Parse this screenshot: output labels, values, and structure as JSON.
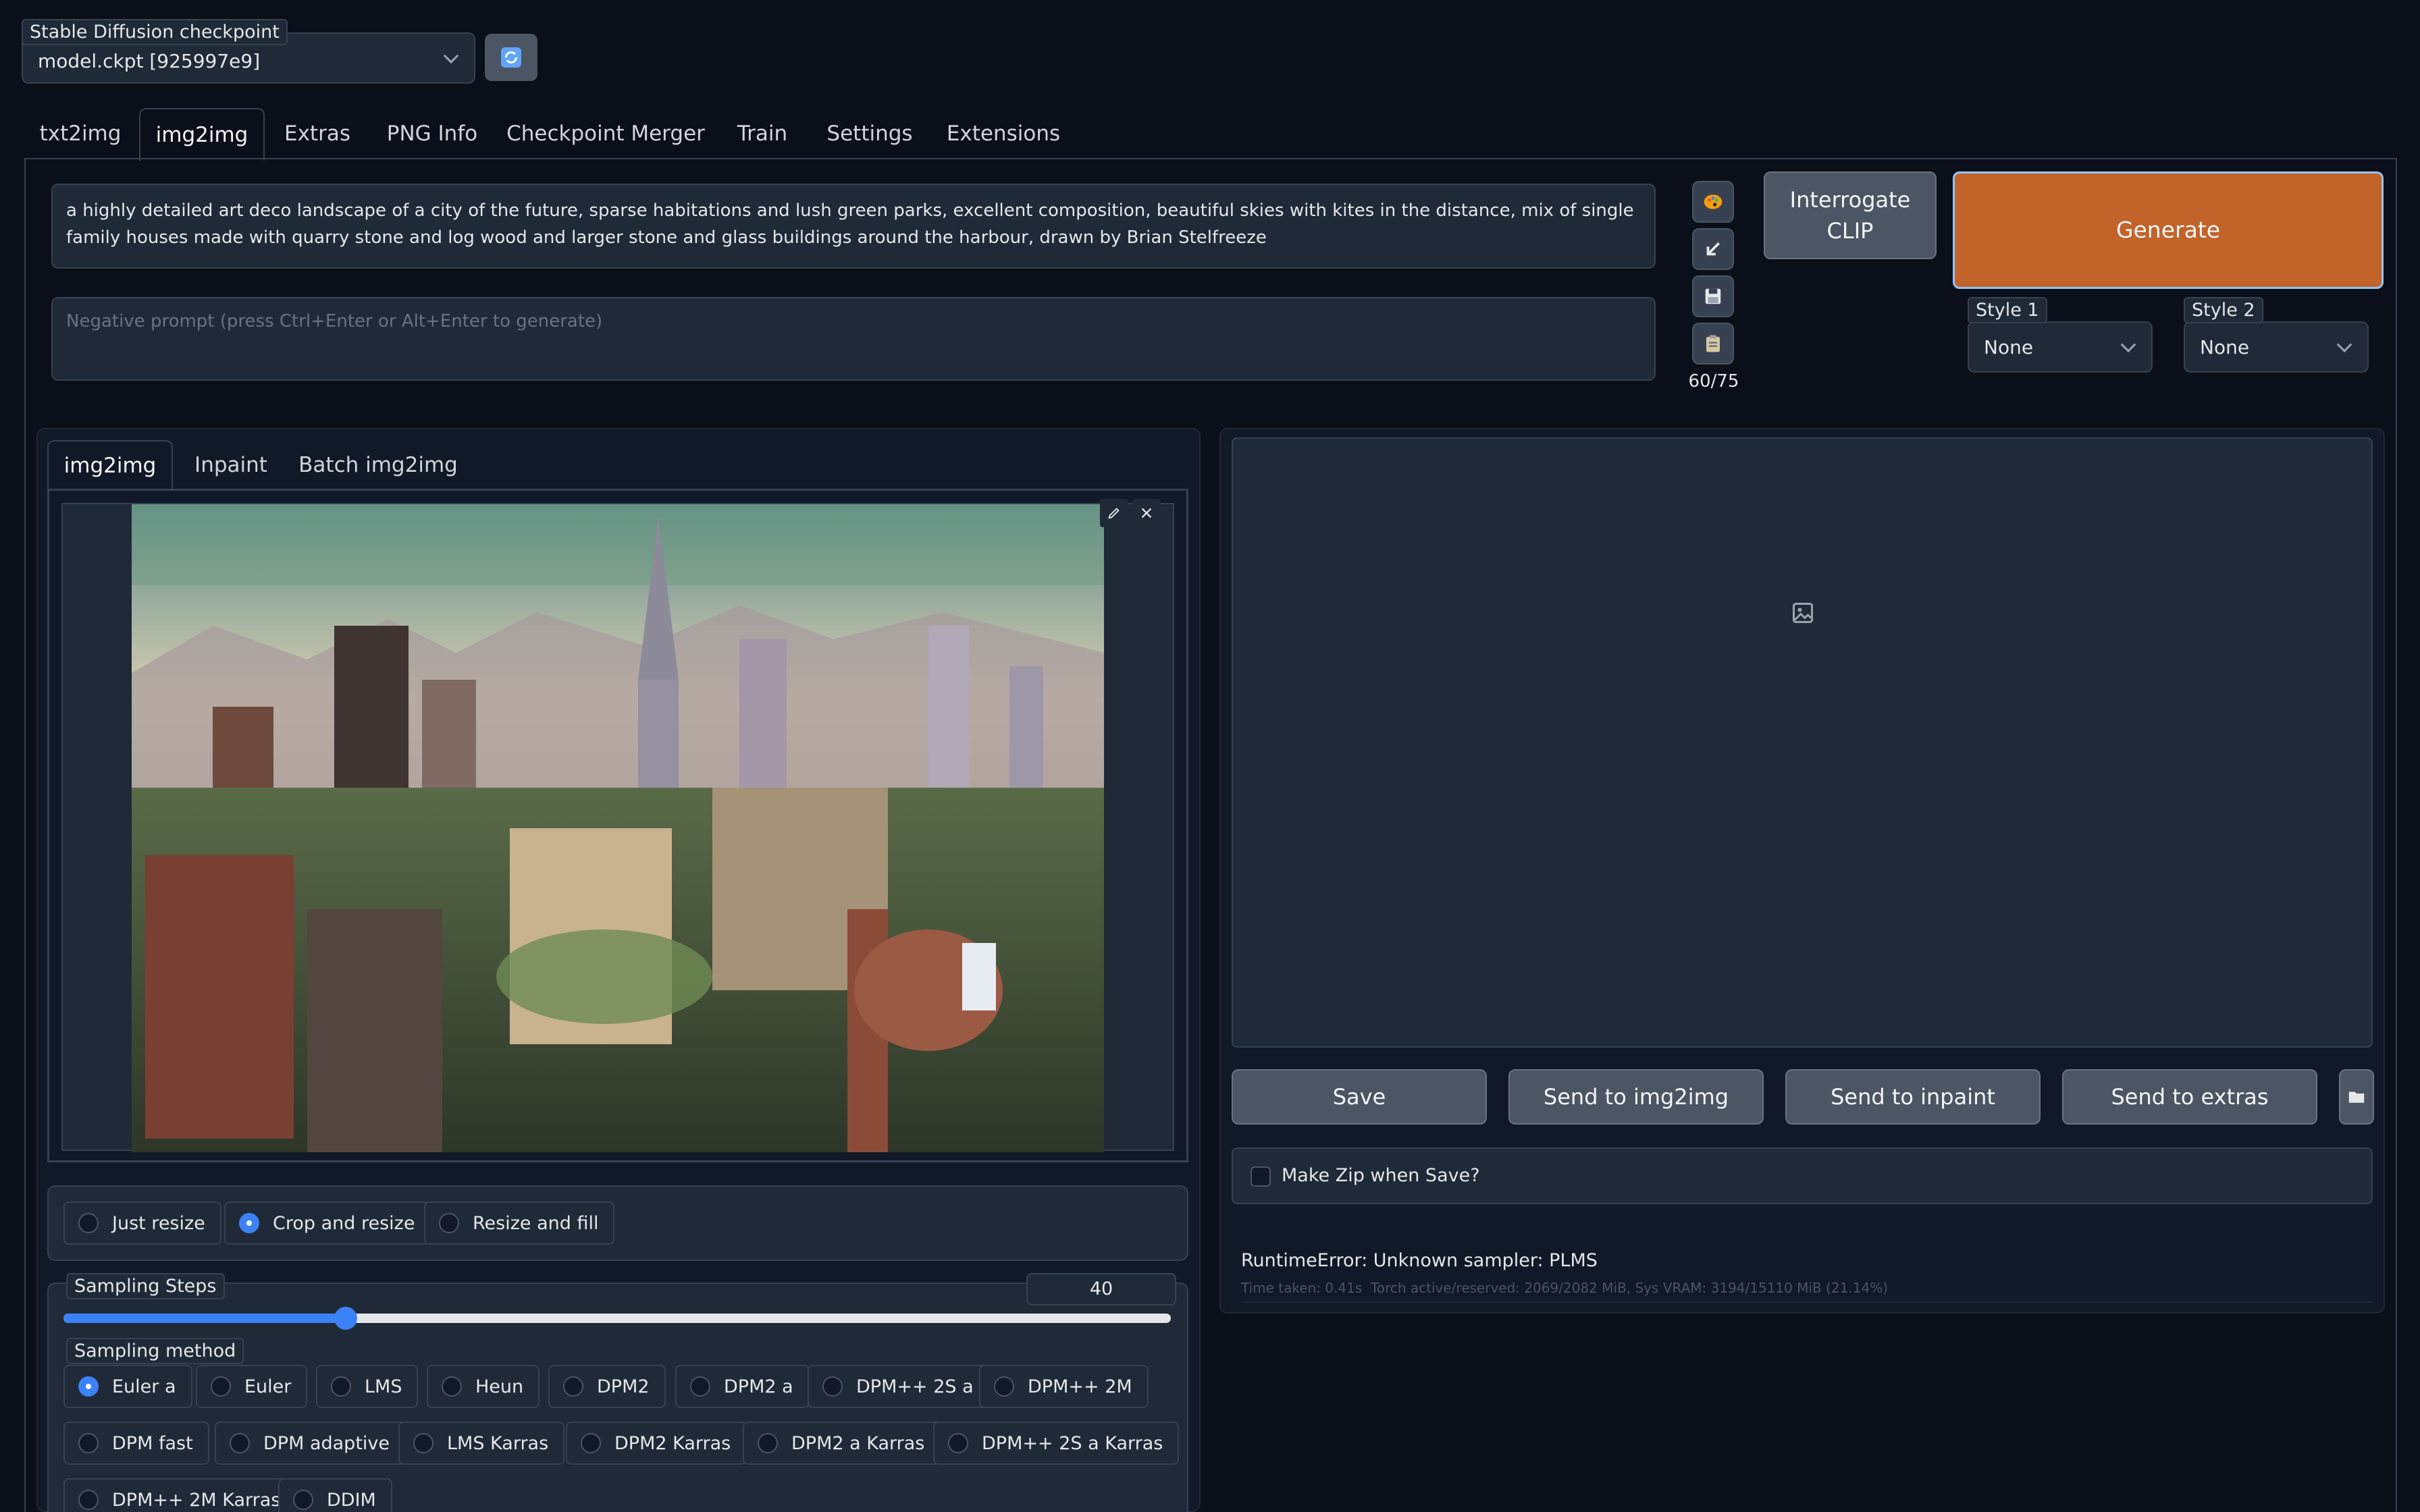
{
  "checkpoint": {
    "label": "Stable Diffusion checkpoint",
    "value": "model.ckpt [925997e9]"
  },
  "tabs": [
    {
      "label": "txt2img",
      "active": false
    },
    {
      "label": "img2img",
      "active": true
    },
    {
      "label": "Extras",
      "active": false
    },
    {
      "label": "PNG Info",
      "active": false
    },
    {
      "label": "Checkpoint Merger",
      "active": false
    },
    {
      "label": "Train",
      "active": false
    },
    {
      "label": "Settings",
      "active": false
    },
    {
      "label": "Extensions",
      "active": false
    }
  ],
  "prompt": {
    "value": "a highly detailed art deco landscape of a city of the future, sparse habitations and lush green parks, excellent composition, beautiful skies with kites in the distance, mix of single family houses made with quarry stone and log wood and larger stone and glass buildings around the harbour, drawn by Brian Stelfreeze",
    "token_count": "60/75"
  },
  "negative_prompt": {
    "placeholder": "Negative prompt (press Ctrl+Enter or Alt+Enter to generate)"
  },
  "side_tools": [
    "palette-icon",
    "arrow-down-left-icon",
    "save-icon",
    "clipboard-icon"
  ],
  "interrogate_label": "Interrogate CLIP",
  "generate_label": "Generate",
  "styles": {
    "style1_label": "Style 1",
    "style1_value": "None",
    "style2_label": "Style 2",
    "style2_value": "None"
  },
  "subtabs": [
    {
      "label": "img2img",
      "active": true
    },
    {
      "label": "Inpaint",
      "active": false
    },
    {
      "label": "Batch img2img",
      "active": false
    }
  ],
  "resize_modes": [
    {
      "label": "Just resize",
      "selected": false
    },
    {
      "label": "Crop and resize",
      "selected": true
    },
    {
      "label": "Resize and fill",
      "selected": false
    }
  ],
  "sampling_steps": {
    "label": "Sampling Steps",
    "value": "40",
    "fraction": 0.255
  },
  "sampling_method": {
    "label": "Sampling method",
    "options": [
      {
        "label": "Euler a",
        "selected": true
      },
      {
        "label": "Euler",
        "selected": false
      },
      {
        "label": "LMS",
        "selected": false
      },
      {
        "label": "Heun",
        "selected": false
      },
      {
        "label": "DPM2",
        "selected": false
      },
      {
        "label": "DPM2 a",
        "selected": false
      },
      {
        "label": "DPM++ 2S a",
        "selected": false
      },
      {
        "label": "DPM++ 2M",
        "selected": false
      },
      {
        "label": "DPM fast",
        "selected": false
      },
      {
        "label": "DPM adaptive",
        "selected": false
      },
      {
        "label": "LMS Karras",
        "selected": false
      },
      {
        "label": "DPM2 Karras",
        "selected": false
      },
      {
        "label": "DPM2 a Karras",
        "selected": false
      },
      {
        "label": "DPM++ 2S a Karras",
        "selected": false
      },
      {
        "label": "DPM++ 2M Karras",
        "selected": false
      },
      {
        "label": "DDIM",
        "selected": false
      }
    ]
  },
  "output_actions": {
    "save": "Save",
    "send_img2img": "Send to img2img",
    "send_inpaint": "Send to inpaint",
    "send_extras": "Send to extras"
  },
  "make_zip_label": "Make Zip when Save?",
  "error_text": "RuntimeError: Unknown sampler: PLMS",
  "stats_text": "Time taken: 0.41s  Torch active/reserved: 2069/2082 MiB, Sys VRAM: 3194/15110 MiB (21.14%)",
  "colors": {
    "background": "#0b0f19",
    "generate": "#c2632a",
    "accent": "#3b82f6"
  }
}
